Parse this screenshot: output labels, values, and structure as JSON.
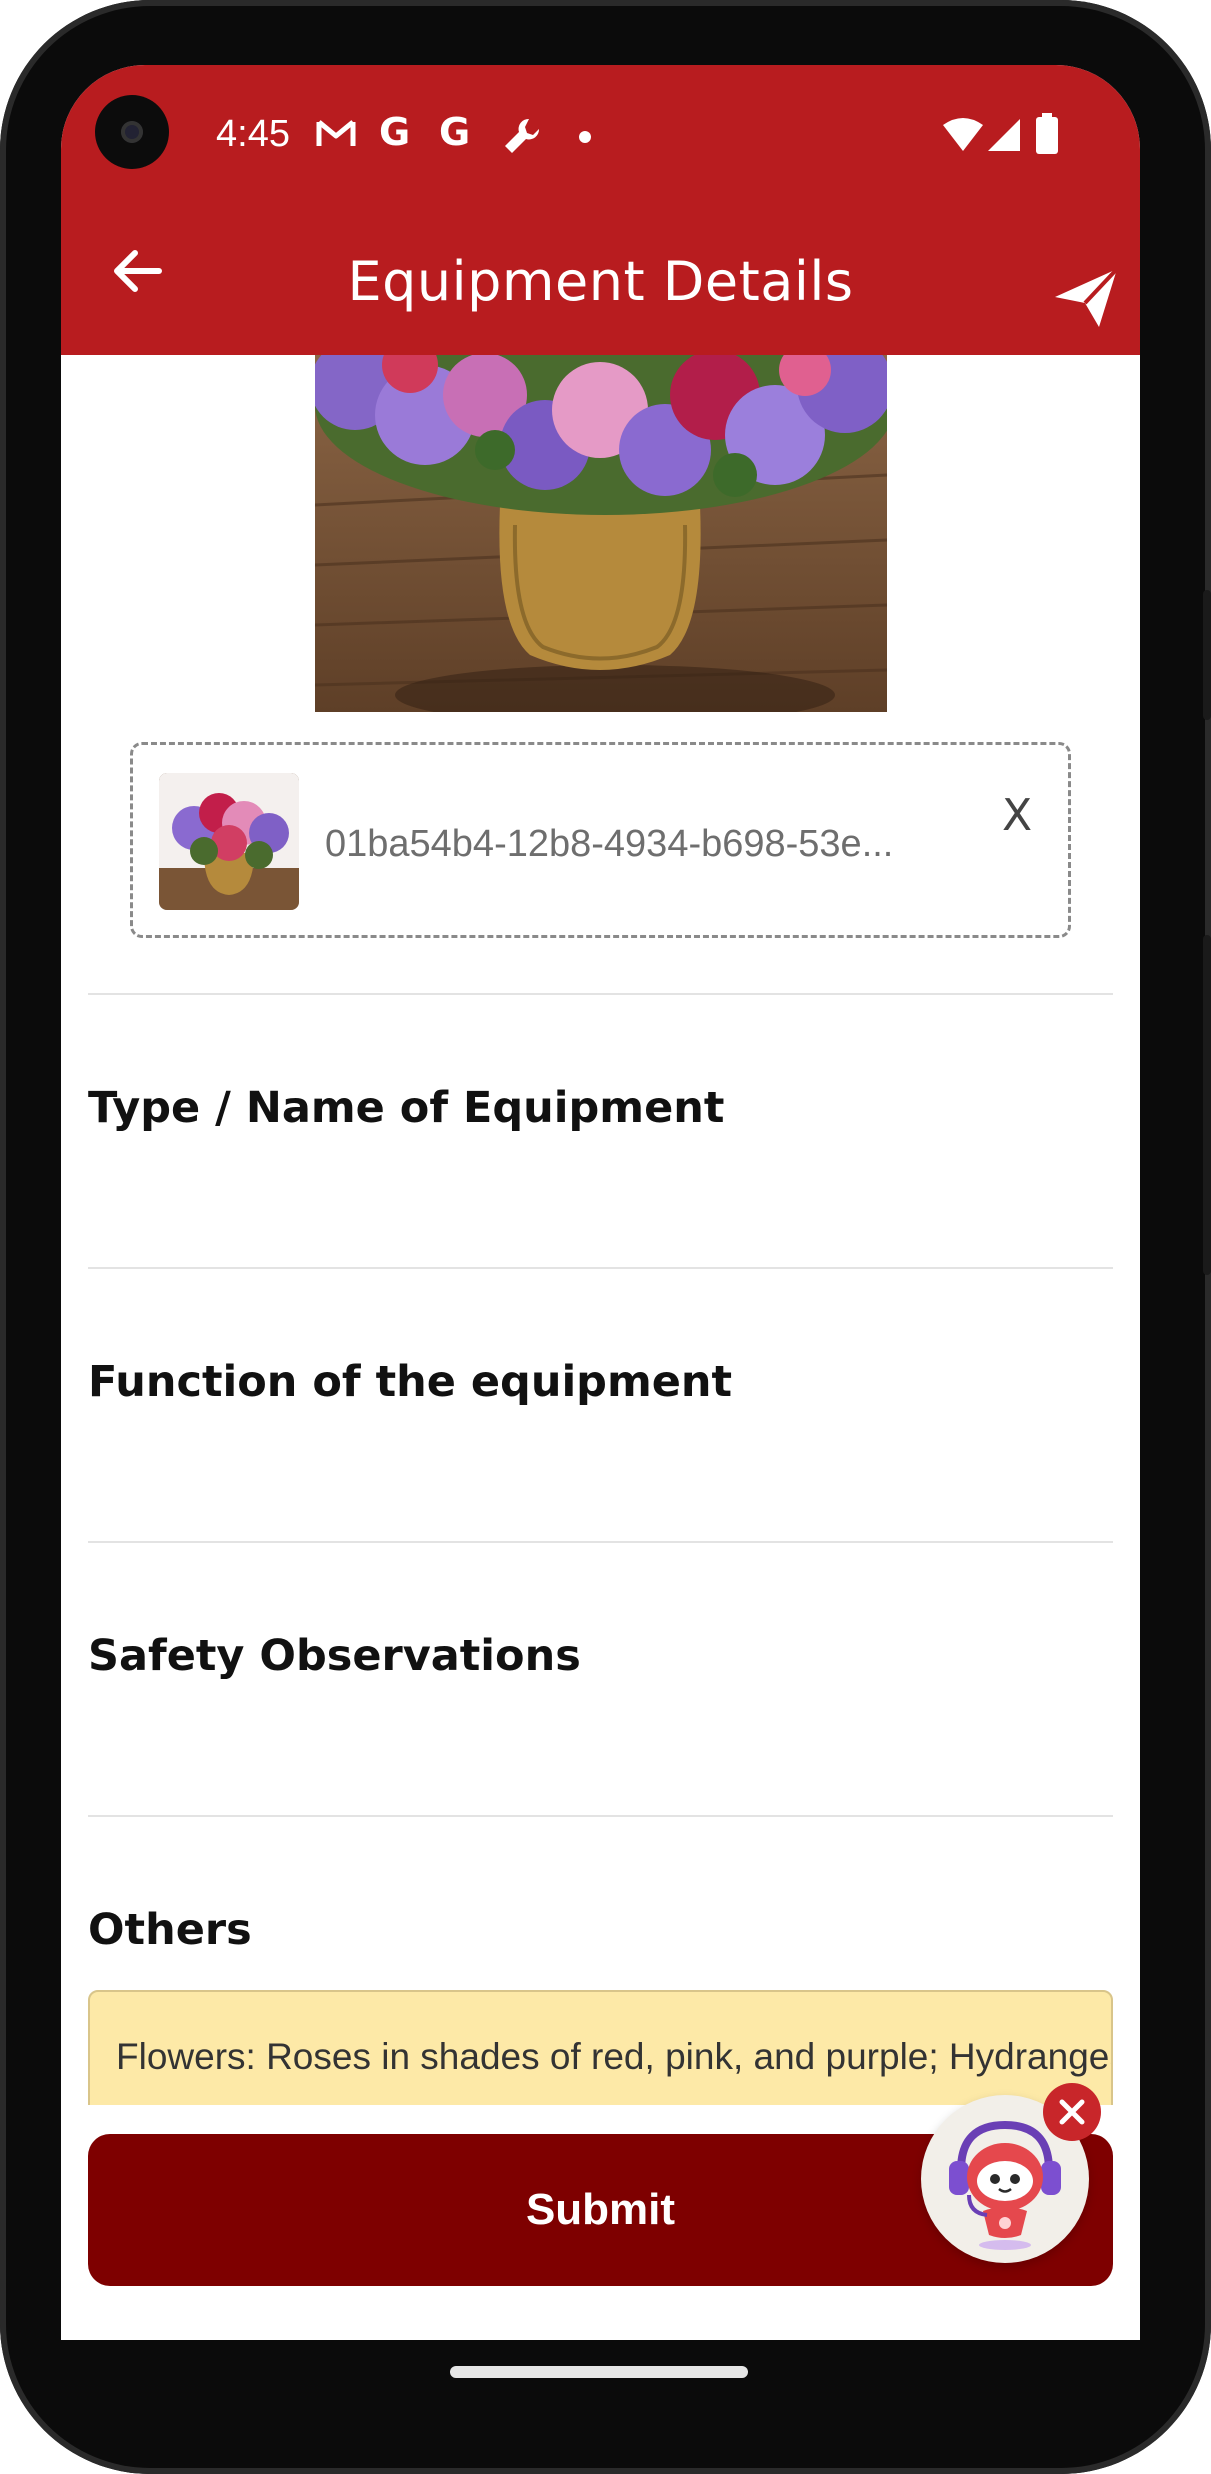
{
  "status_bar": {
    "time": "4:45",
    "icons": [
      "gmail-icon",
      "google-icon",
      "google-icon",
      "wrench-icon",
      "dot-icon",
      "wifi-icon",
      "signal-icon",
      "battery-icon"
    ]
  },
  "app_bar": {
    "title": "Equipment Details",
    "back_icon": "arrow-left-icon",
    "send_icon": "send-icon"
  },
  "attachment": {
    "file_name": "01ba54b4-12b8-4934-b698-53e...",
    "remove_label": "X"
  },
  "form": {
    "fields": [
      {
        "label": "Type / Name of Equipment",
        "value": ""
      },
      {
        "label": "Function of the equipment",
        "value": ""
      },
      {
        "label": "Safety Observations",
        "value": ""
      },
      {
        "label": "Others",
        "value": "Flowers: Roses in shades of red, pink, and purple; Hydrangeas"
      }
    ]
  },
  "actions": {
    "submit_label": "Submit"
  },
  "assistant": {
    "close_icon": "close-icon",
    "avatar_icon": "robot-assistant-icon"
  },
  "colors": {
    "header": "#b81c1f",
    "submit": "#7e0000",
    "others_field": "#fde9a7"
  }
}
